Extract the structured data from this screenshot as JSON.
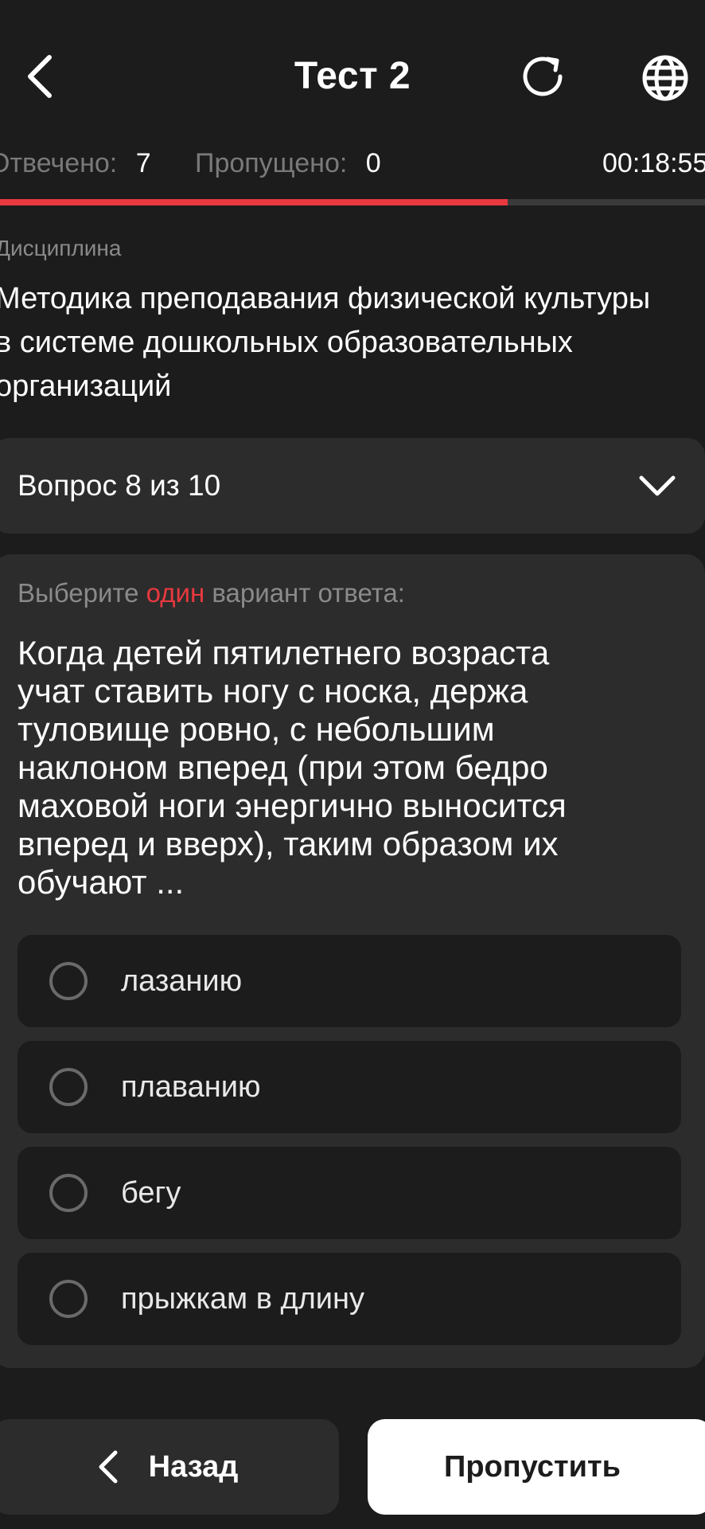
{
  "header": {
    "title": "Тест 2",
    "back_icon": "chevron-left-icon",
    "reload_icon": "reload-icon",
    "language_icon": "globe-icon"
  },
  "stats": {
    "answered_label": "Отвечено:",
    "answered_value": "7",
    "skipped_label": "Пропущено:",
    "skipped_value": "0",
    "timer": "00:18:55"
  },
  "progress": {
    "fraction": 0.72,
    "fill_color": "#e8393f",
    "track_color": "#3a3a3a"
  },
  "discipline": {
    "label": "Дисциплина",
    "name": "Методика преподавания физической культуры\nв системе дошкольных образовательных\nорганизаций"
  },
  "question_selector": {
    "label": "Вопрос 8 из 10",
    "icon": "chevron-down-icon"
  },
  "question": {
    "instruction_prefix": "Выберите ",
    "instruction_accent": "один",
    "instruction_suffix": " вариант ответа:",
    "text": "Когда детей пятилетнего возраста\nучат ставить ногу с носка, держа\nтуловище ровно, с небольшим\nнаклоном вперед (при этом бедро\nмаховой ноги энергично выносится\nвперед и вверх), таким образом их\nобучают ...",
    "options": [
      {
        "label": "лазанию",
        "selected": false
      },
      {
        "label": "плаванию",
        "selected": false
      },
      {
        "label": "бегу",
        "selected": false
      },
      {
        "label": "прыжкам в длину",
        "selected": false
      }
    ]
  },
  "footer": {
    "back_label": "Назад",
    "skip_label": "Пропустить"
  },
  "colors": {
    "background": "#1c1c1c",
    "card": "#2c2c2c",
    "accent": "#e8393f"
  }
}
